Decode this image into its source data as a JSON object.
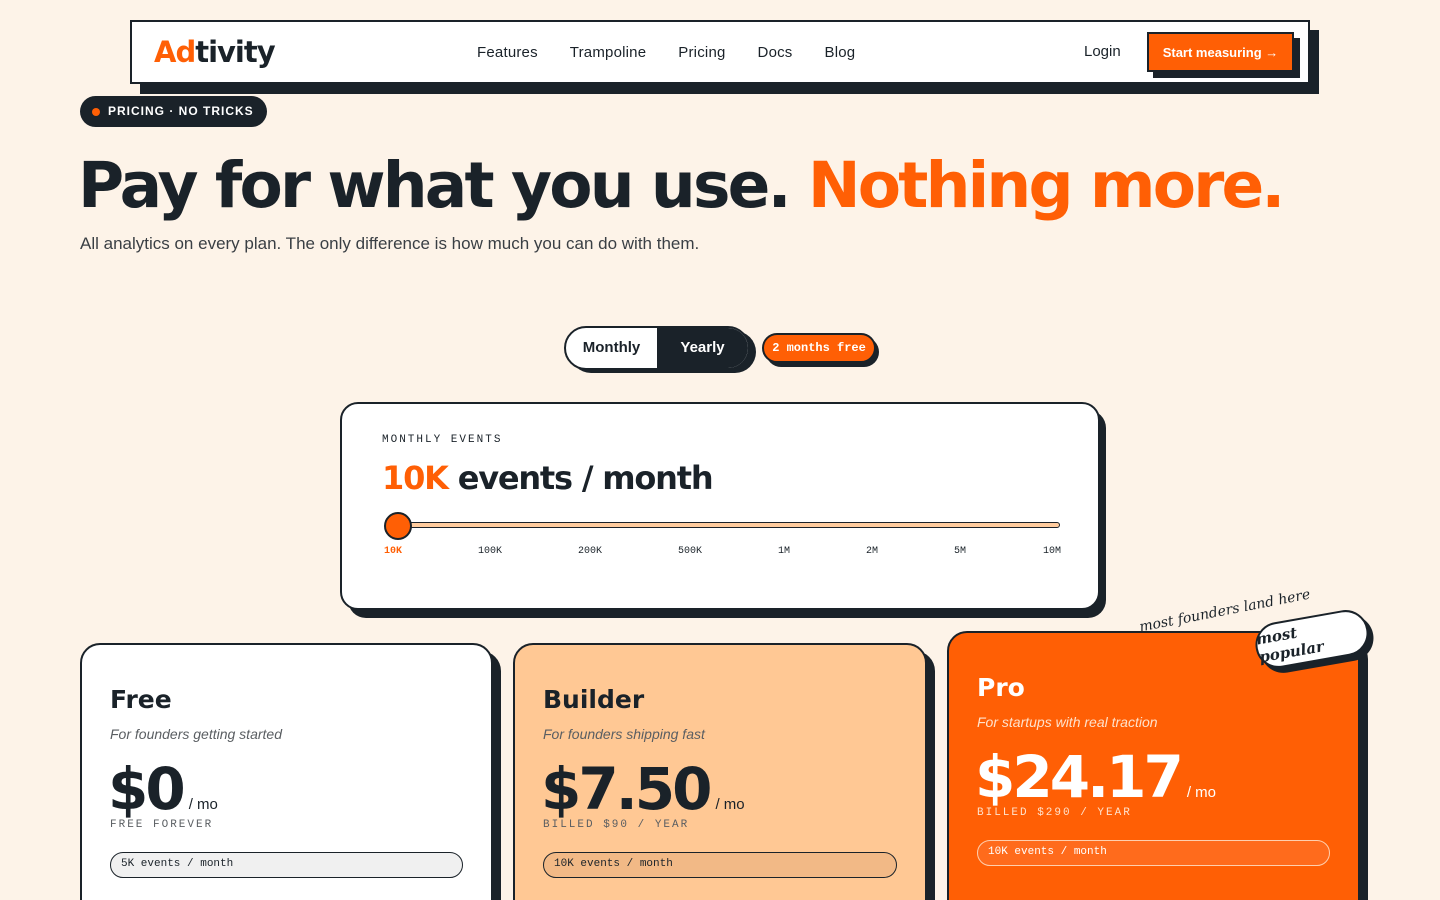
{
  "nav": {
    "logo_accent": "Ad",
    "logo_rest": "tivity",
    "links": [
      "Features",
      "Trampoline",
      "Pricing",
      "Docs",
      "Blog"
    ],
    "login": "Login",
    "cta": "Start measuring →"
  },
  "hero": {
    "badge": "PRICING · NO TRICKS",
    "title_main": "Pay for what you use.",
    "title_highlight": "Nothing more.",
    "subtitle": "All analytics on every plan. The only difference is how much you can do with them."
  },
  "billing": {
    "monthly": "Monthly",
    "yearly": "Yearly",
    "selected": "Yearly",
    "promo": "2 months free"
  },
  "slider": {
    "label": "MONTHLY EVENTS",
    "value": "10K",
    "value_suffix": "events / month",
    "ticks": [
      "10K",
      "100K",
      "200K",
      "500K",
      "1M",
      "2M",
      "5M",
      "10M"
    ],
    "selected_index": 0
  },
  "plans": [
    {
      "name": "Free",
      "tagline": "For founders getting started",
      "price": "$0",
      "per": "/ mo",
      "billing": "FREE FOREVER",
      "events": "5K events / month"
    },
    {
      "name": "Builder",
      "tagline": "For founders shipping fast",
      "price": "$7.50",
      "per": "/ mo",
      "billing": "BILLED $90 / YEAR",
      "events": "10K events / month"
    },
    {
      "name": "Pro",
      "tagline": "For startups with real traction",
      "price": "$24.17",
      "per": "/ mo",
      "billing": "BILLED $290 / YEAR",
      "events": "10K events / month"
    }
  ],
  "popular": {
    "note": "most founders land here",
    "tag": "most popular"
  },
  "colors": {
    "background": "#fdf3e8",
    "accent": "#ff5f05",
    "ink": "#1a2229",
    "builder_card": "#ffc894"
  }
}
